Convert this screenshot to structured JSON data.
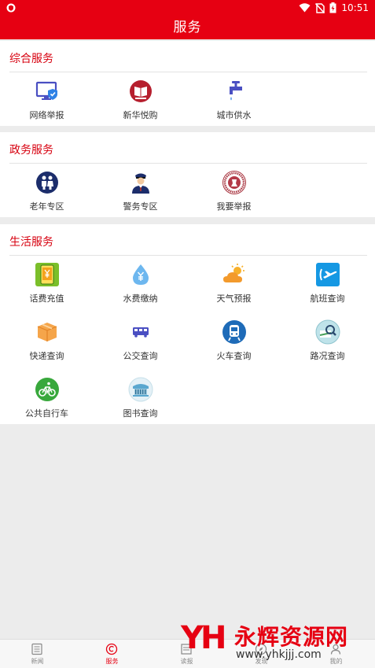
{
  "status_bar": {
    "time": "10:51"
  },
  "header": {
    "title": "服务"
  },
  "sections": [
    {
      "title": "综合服务",
      "items": [
        {
          "label": "网络举报",
          "icon": "monitor-shield-icon"
        },
        {
          "label": "新华悦购",
          "icon": "xinhua-shop-icon"
        },
        {
          "label": "城市供水",
          "icon": "faucet-icon"
        }
      ]
    },
    {
      "title": "政务服务",
      "items": [
        {
          "label": "老年专区",
          "icon": "elderly-icon"
        },
        {
          "label": "警务专区",
          "icon": "police-icon"
        },
        {
          "label": "我要举报",
          "icon": "report-seal-icon"
        }
      ]
    },
    {
      "title": "生活服务",
      "items": [
        {
          "label": "话费充值",
          "icon": "phone-recharge-icon"
        },
        {
          "label": "水费缴纳",
          "icon": "water-drop-icon"
        },
        {
          "label": "天气预报",
          "icon": "weather-icon"
        },
        {
          "label": "航班查询",
          "icon": "flight-icon"
        },
        {
          "label": "快递查询",
          "icon": "package-icon"
        },
        {
          "label": "公交查询",
          "icon": "bus-icon"
        },
        {
          "label": "火车查询",
          "icon": "train-icon"
        },
        {
          "label": "路况查询",
          "icon": "road-search-icon"
        },
        {
          "label": "公共自行车",
          "icon": "bicycle-icon"
        },
        {
          "label": "图书查询",
          "icon": "library-icon"
        }
      ]
    }
  ],
  "tab_bar": {
    "tabs": [
      {
        "label": "新闻",
        "icon": "news-icon",
        "active": false
      },
      {
        "label": "服务",
        "icon": "service-icon",
        "active": true
      },
      {
        "label": "读报",
        "icon": "newspaper-icon",
        "active": false
      },
      {
        "label": "发现",
        "icon": "discover-icon",
        "active": false
      },
      {
        "label": "我的",
        "icon": "profile-icon",
        "active": false
      }
    ]
  },
  "watermark": {
    "logo": "YH",
    "title": "永辉资源网",
    "url": "www.yhkjjj.com"
  },
  "colors": {
    "brand_red": "#e60012",
    "section_title": "#d7000f",
    "background": "#ececec"
  }
}
